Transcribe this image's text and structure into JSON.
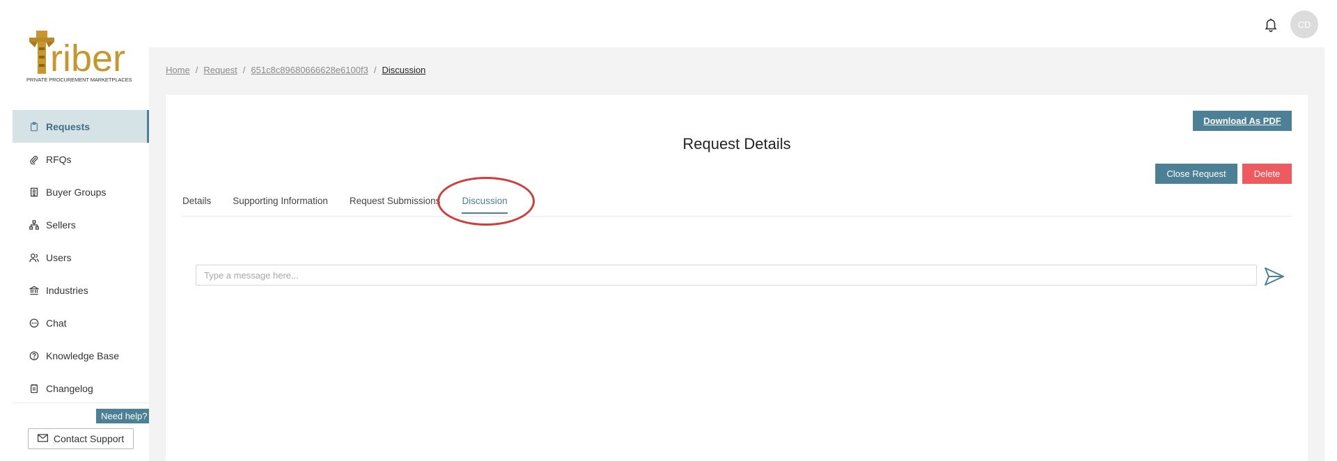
{
  "brand": {
    "logo_text": "riber",
    "tagline": "PRIVATE PROCUREMENT MARKETPLACES"
  },
  "header": {
    "avatar_initials": "CD"
  },
  "sidebar": {
    "items": [
      {
        "label": "Requests",
        "icon": "clipboard-icon",
        "active": true
      },
      {
        "label": "RFQs",
        "icon": "paperclip-icon",
        "active": false
      },
      {
        "label": "Buyer Groups",
        "icon": "building-icon",
        "active": false
      },
      {
        "label": "Sellers",
        "icon": "network-icon",
        "active": false
      },
      {
        "label": "Users",
        "icon": "users-icon",
        "active": false
      },
      {
        "label": "Industries",
        "icon": "bank-icon",
        "active": false
      },
      {
        "label": "Chat",
        "icon": "chat-icon",
        "active": false
      },
      {
        "label": "Knowledge Base",
        "icon": "help-circle-icon",
        "active": false
      },
      {
        "label": "Changelog",
        "icon": "document-icon",
        "active": false
      }
    ],
    "need_help_label": "Need help?",
    "contact_support_label": "Contact Support"
  },
  "breadcrumb": {
    "items": [
      "Home",
      "Request",
      "651c8c89680666628e6100f3",
      "Discussion"
    ]
  },
  "card": {
    "title": "Request Details",
    "download_pdf_label": "Download As PDF",
    "close_request_label": "Close Request",
    "delete_label": "Delete",
    "tabs": [
      "Details",
      "Supporting Information",
      "Request Submissions",
      "Discussion"
    ],
    "active_tab": "Discussion"
  },
  "discussion": {
    "message_placeholder": "Type a message here..."
  },
  "colors": {
    "accent": "#4b8097",
    "danger": "#ef5a5f",
    "highlight": "#d23c3c",
    "logo_gold": "#c8962e"
  }
}
